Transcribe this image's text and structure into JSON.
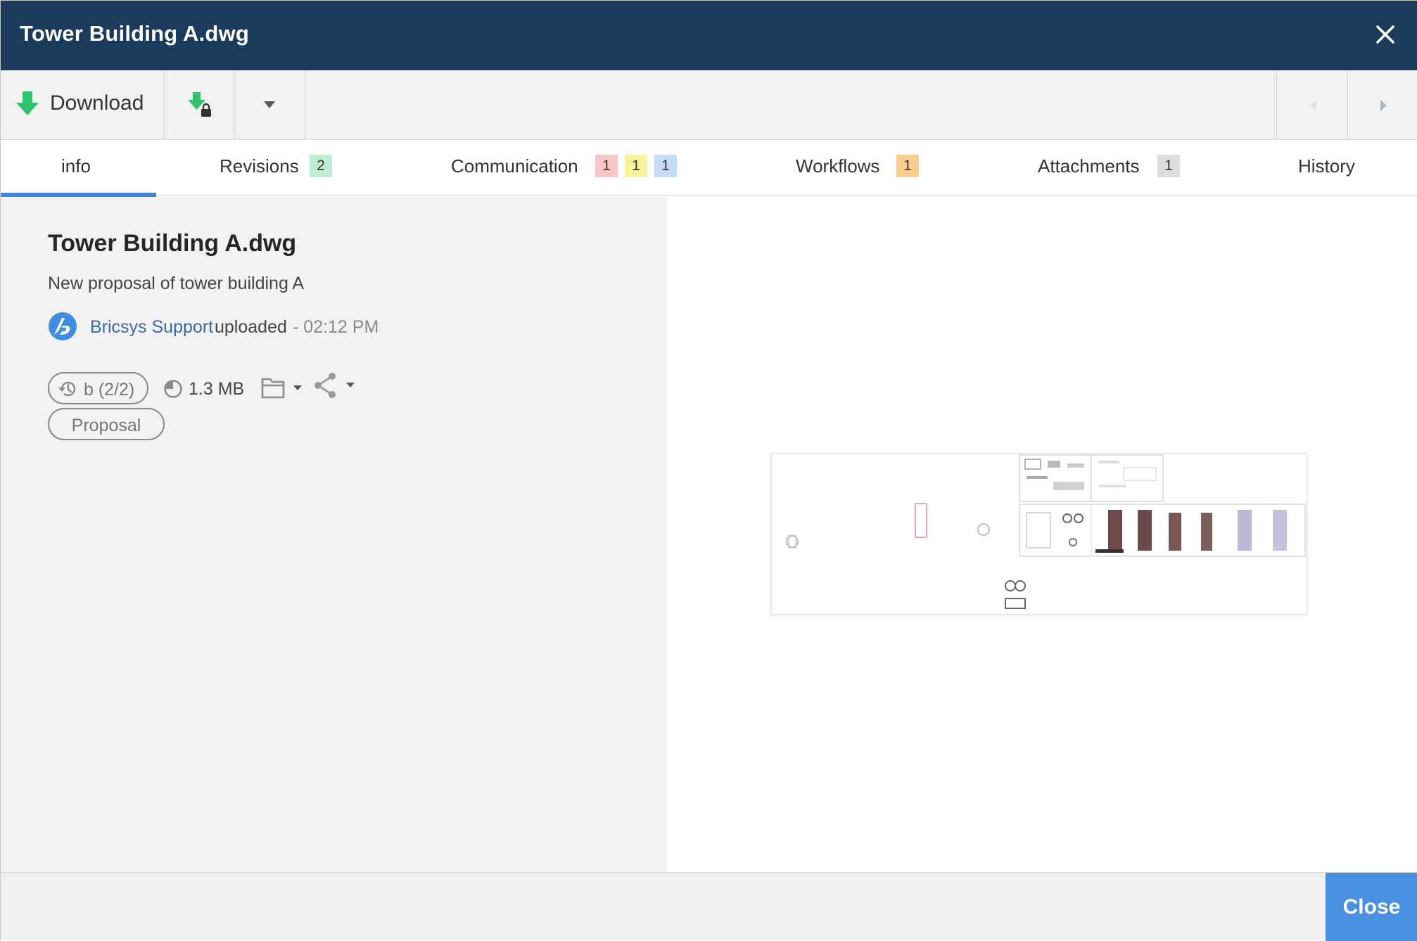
{
  "window": {
    "title": "Tower Building A.dwg"
  },
  "toolbar": {
    "download_label": "Download"
  },
  "tabs": [
    {
      "label": "info",
      "badges": []
    },
    {
      "label": "Revisions",
      "badges": [
        "2"
      ]
    },
    {
      "label": "Communication",
      "badges": [
        "1",
        "1",
        "1"
      ]
    },
    {
      "label": "Workflows",
      "badges": [
        "1"
      ]
    },
    {
      "label": "Attachments",
      "badges": [
        "1"
      ]
    },
    {
      "label": "History",
      "badges": []
    }
  ],
  "info": {
    "title": "Tower Building A.dwg",
    "description": "New proposal of tower building A",
    "uploader_name": "Bricsys Support",
    "uploader_action": "uploaded",
    "upload_time": "- 02:12 PM",
    "revision": "b (2/2)",
    "file_size": "1.3 MB",
    "tag": "Proposal"
  },
  "footer": {
    "close_label": "Close"
  },
  "colors": {
    "titlebar": "#1b3a5c",
    "accent": "#3b86e0",
    "close_button": "#4a90e2",
    "download_green": "#33c26b"
  },
  "icons": {
    "close": "close-icon",
    "download": "download-arrow-icon",
    "secure_download": "download-lock-icon",
    "revision": "history-icon",
    "size": "pie-icon",
    "folder": "folder-icon",
    "share": "share-icon"
  }
}
